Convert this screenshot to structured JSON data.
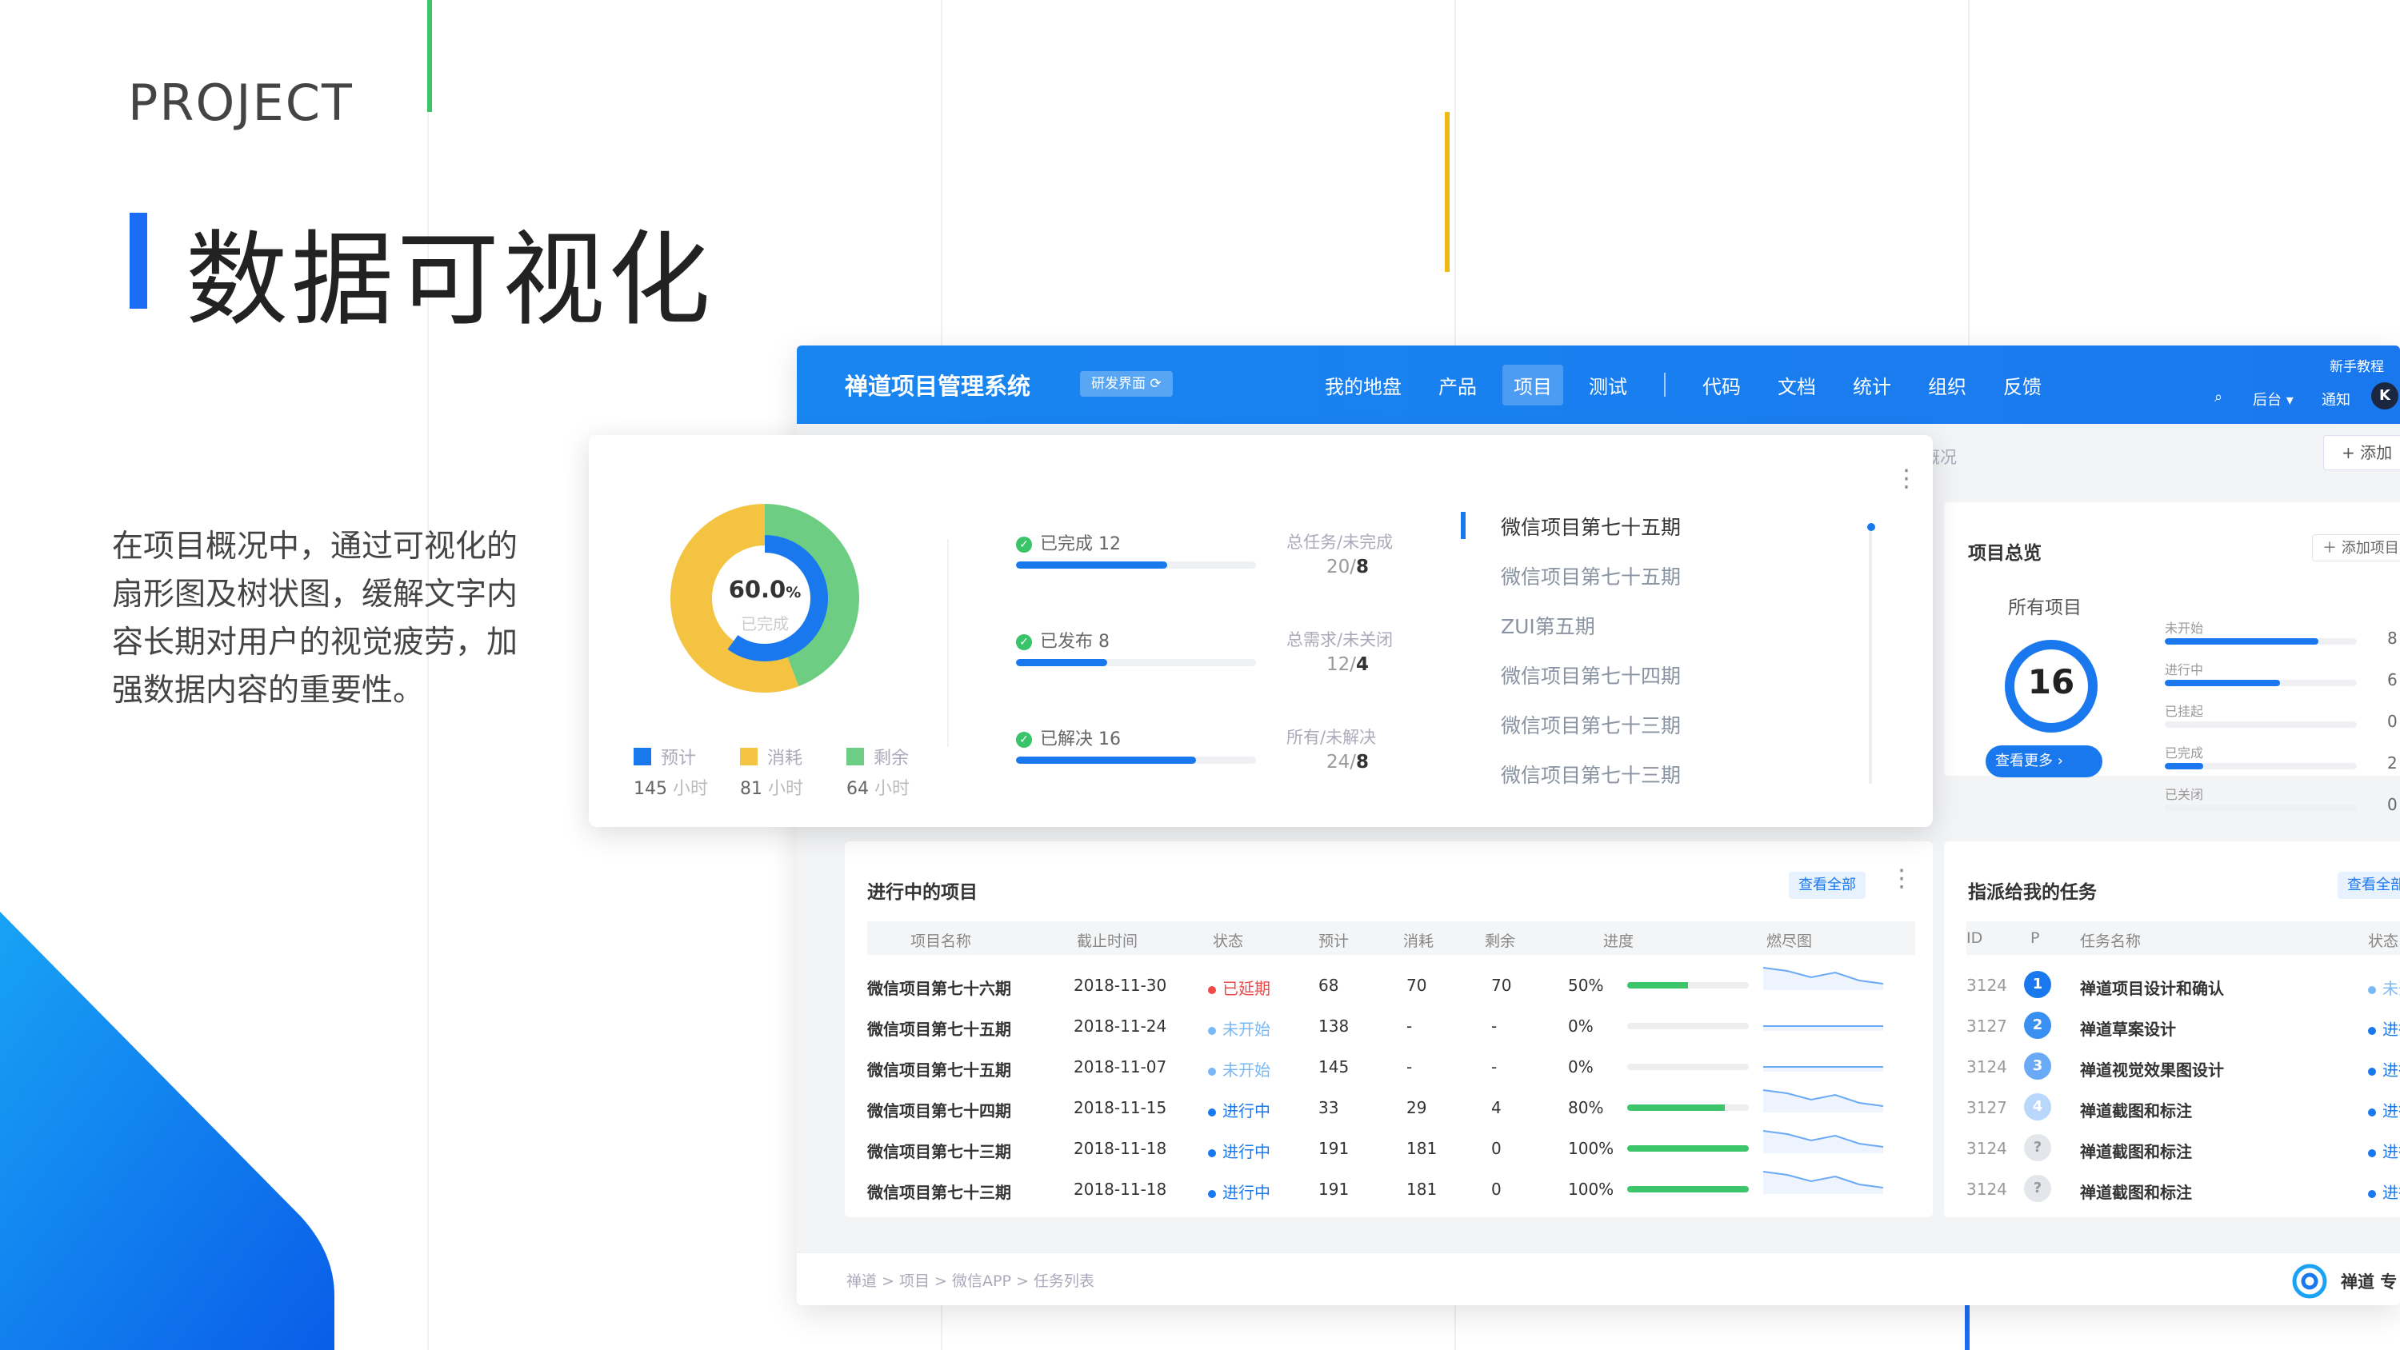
{
  "slide": {
    "eyebrow": "PROJECT",
    "title": "数据可视化",
    "description": "在项目概况中，通过可视化的扇形图及树状图，缓解文字内容长期对用户的视觉疲劳，加强数据内容的重要性。"
  },
  "colors": {
    "brand": "#1a78ef",
    "yellow": "#f5c342",
    "green": "#6ccd83",
    "red": "#f24848",
    "nav": "#1886f0"
  },
  "nav": {
    "brand": "禅道项目管理系统",
    "badge": "研发界面",
    "items": [
      "我的地盘",
      "产品",
      "项目",
      "测试",
      "代码",
      "文档",
      "统计",
      "组织",
      "反馈"
    ],
    "active": "项目",
    "help": "新手教程",
    "backend": "后台",
    "notify": "通知",
    "avatar": "K"
  },
  "breadcrumb_top": "概况",
  "add_button": "添加",
  "overview": {
    "donut": {
      "percent": "60.0",
      "unit": "%",
      "label": "已完成"
    },
    "legend": [
      {
        "name": "预计",
        "value": "145",
        "unit": "小时"
      },
      {
        "name": "消耗",
        "value": "81",
        "unit": "小时"
      },
      {
        "name": "剩余",
        "value": "64",
        "unit": "小时"
      }
    ],
    "stats": [
      {
        "label": "已完成 12",
        "progress": 0.63,
        "sub_label": "总任务/未完成",
        "total": "20/",
        "remain": "8"
      },
      {
        "label": "已发布 8",
        "progress": 0.38,
        "sub_label": "总需求/未关闭",
        "total": "12/",
        "remain": "4"
      },
      {
        "label": "已解决 16",
        "progress": 0.75,
        "sub_label": "所有/未解决",
        "total": "24/",
        "remain": "8"
      }
    ],
    "timeline": [
      "微信项目第七十五期",
      "微信项目第七十五期",
      "ZUI第五期",
      "微信项目第七十四期",
      "微信项目第七十三期",
      "微信项目第七十三期"
    ]
  },
  "project_overview": {
    "title": "项目总览",
    "add": "添加项目",
    "all_label": "所有项目",
    "count": "16",
    "more": "查看更多",
    "bars": [
      {
        "label": "未开始",
        "value": "8",
        "fill": 0.8
      },
      {
        "label": "进行中",
        "value": "6",
        "fill": 0.6
      },
      {
        "label": "已挂起",
        "value": "0",
        "fill": 0
      },
      {
        "label": "已完成",
        "value": "2",
        "fill": 0.2
      },
      {
        "label": "已关闭",
        "value": "0",
        "fill": 0
      }
    ]
  },
  "ongoing": {
    "title": "进行中的项目",
    "view_all": "查看全部",
    "headers": [
      "项目名称",
      "截止时间",
      "状态",
      "预计",
      "消耗",
      "剩余",
      "进度",
      "燃尽图"
    ],
    "rows": [
      {
        "name": "微信项目第七十六期",
        "date": "2018-11-30",
        "status": "已延期",
        "sc": "#f24848",
        "est": "68",
        "used": "70",
        "left": "70",
        "pct": "50%",
        "p": 0.5
      },
      {
        "name": "微信项目第七十五期",
        "date": "2018-11-24",
        "status": "未开始",
        "sc": "#7ab8f5",
        "est": "138",
        "used": "-",
        "left": "-",
        "pct": "0%",
        "p": 0
      },
      {
        "name": "微信项目第七十五期",
        "date": "2018-11-07",
        "status": "未开始",
        "sc": "#7ab8f5",
        "est": "145",
        "used": "-",
        "left": "-",
        "pct": "0%",
        "p": 0
      },
      {
        "name": "微信项目第七十四期",
        "date": "2018-11-15",
        "status": "进行中",
        "sc": "#1a78ef",
        "est": "33",
        "used": "29",
        "left": "4",
        "pct": "80%",
        "p": 0.8
      },
      {
        "name": "微信项目第七十三期",
        "date": "2018-11-18",
        "status": "进行中",
        "sc": "#1a78ef",
        "est": "191",
        "used": "181",
        "left": "0",
        "pct": "100%",
        "p": 1
      },
      {
        "name": "微信项目第七十三期",
        "date": "2018-11-18",
        "status": "进行中",
        "sc": "#1a78ef",
        "est": "191",
        "used": "181",
        "left": "0",
        "pct": "100%",
        "p": 1
      }
    ]
  },
  "tasks": {
    "title": "指派给我的任务",
    "view_all": "查看全部",
    "headers": [
      "ID",
      "P",
      "任务名称",
      "状态"
    ],
    "rows": [
      {
        "id": "3124",
        "p": "1",
        "pc": "#1a78ef",
        "name": "禅道项目设计和确认",
        "status": "未开始",
        "sc": "#7ab8f5"
      },
      {
        "id": "3127",
        "p": "2",
        "pc": "#3a8ff2",
        "name": "禅道草案设计",
        "status": "进行中",
        "sc": "#1a78ef"
      },
      {
        "id": "3124",
        "p": "3",
        "pc": "#6aa9f5",
        "name": "禅道视觉效果图设计",
        "status": "进行中",
        "sc": "#1a78ef"
      },
      {
        "id": "3127",
        "p": "4",
        "pc": "#b9d6fb",
        "name": "禅道截图和标注",
        "status": "进行中",
        "sc": "#1a78ef"
      },
      {
        "id": "3124",
        "p": "?",
        "pc": "#e3e6ea",
        "name": "禅道截图和标注",
        "status": "进行中",
        "sc": "#1a78ef"
      },
      {
        "id": "3124",
        "p": "?",
        "pc": "#e3e6ea",
        "name": "禅道截图和标注",
        "status": "进行中",
        "sc": "#1a78ef"
      }
    ]
  },
  "footer": {
    "path": "禅道 > 项目 > 微信APP > 任务列表",
    "brand": "禅道 专"
  }
}
